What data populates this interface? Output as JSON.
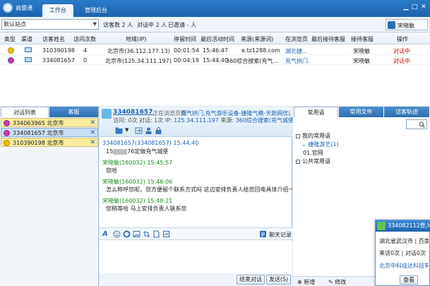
{
  "app": {
    "name": "商盟通"
  },
  "tabs": [
    {
      "label": "工作台"
    },
    {
      "label": "管理后台"
    }
  ],
  "window": {
    "minimize": "▁",
    "maximize": "□",
    "close": "✕"
  },
  "toolbar": {
    "site_select": "默认站点",
    "visitors_label": "访客数 2 人",
    "dialogs_label": "对话中 2 人",
    "invited_label": "已邀请 - 人",
    "user_name": "宋晓敏"
  },
  "visitor_table": {
    "columns": [
      "类型",
      "渠道",
      "访客姓名",
      "访问次数",
      "地域(IP)",
      "停留时间",
      "最后活动时间",
      "来源(来源词)",
      "在浏览页",
      "最后接待客服",
      "接待客服",
      "操作"
    ],
    "rows": [
      {
        "name": "310390198",
        "visits": "4",
        "region": "北京市(36.112.177.13)",
        "stay": "00:01:54",
        "last_active": "15:46:47",
        "source": "e.tz1288.com",
        "page": "湖北捷...",
        "last_staff": "",
        "staff": "宋晓敏",
        "action": "对话中",
        "icon_color": "#e8c000"
      },
      {
        "name": "334081657",
        "visits": "0",
        "region": "北京市(125.34.111.197)",
        "stay": "00:04:19",
        "last_active": "15:44:40",
        "source": "360综合搜索(充气...",
        "page": "充气拱门...",
        "last_staff": "",
        "staff": "宋晓敏",
        "action": "对话中",
        "icon_color": "#c43bb5"
      }
    ]
  },
  "left_tabs": [
    {
      "label": "对话列表"
    },
    {
      "label": "客服"
    }
  ],
  "conversations": [
    {
      "label": "334063965 北京市",
      "close": "✕",
      "selected": false,
      "icon_color": "#c43bb5"
    },
    {
      "label": "334081657 北京市",
      "close": "✕",
      "selected": true,
      "icon_color": "#c43bb5"
    },
    {
      "label": "310390198 北京市",
      "close": "✕",
      "selected": false,
      "icon_color": "#e8c000"
    }
  ],
  "chat": {
    "visitor_id": "334081657",
    "browsing_label": "正在浏览页面:",
    "page_title": "充气拱门,充气游乐设备-捷隆气模-天助网优选",
    "visit_info": "访问: 0次 对话: 1次 IP:",
    "ip": "125.34.111.197",
    "source_label": "来源:",
    "source_value": "360综合搜索(充气城堡)",
    "messages": [
      {
        "meta": "334081657(334081657)  15:44:40",
        "text_before": "15",
        "text_after": "76定做充气城堡",
        "role": "visitor"
      },
      {
        "meta": "宋晓敏(160032)  15:45:57",
        "text": "您哈",
        "role": "staff"
      },
      {
        "meta": "宋晓敏(160032)  15:46:06",
        "text": "怎么称呼您呢，您方便留个联系方式吗 这边安排负责人给您回电具体介绍一下哈",
        "role": "staff"
      },
      {
        "meta": "宋晓敏(160032)  15:48:21",
        "text": "您稍等哈  马上安排负责人联系您",
        "role": "staff"
      }
    ],
    "history_label": "聊天记录",
    "end_button": "结束对话",
    "send_button": "发送(S)"
  },
  "right_tabs": [
    {
      "label": "常用语"
    },
    {
      "label": "常用文件"
    },
    {
      "label": "访客轨迹"
    }
  ],
  "phrases": {
    "my_group": "我的常用语",
    "sub_group": "捷隆游艺(1)",
    "item": "01.官网",
    "public_group": "公共常用语",
    "add": "新增",
    "edit": "修改"
  },
  "popup": {
    "title": "334082112登入(充气...",
    "region": "湖北省武汉市 | 百度",
    "stats": "来访0次 | 对话0次",
    "company": "北京中科技达科技有限公司",
    "view_button": "查看"
  }
}
